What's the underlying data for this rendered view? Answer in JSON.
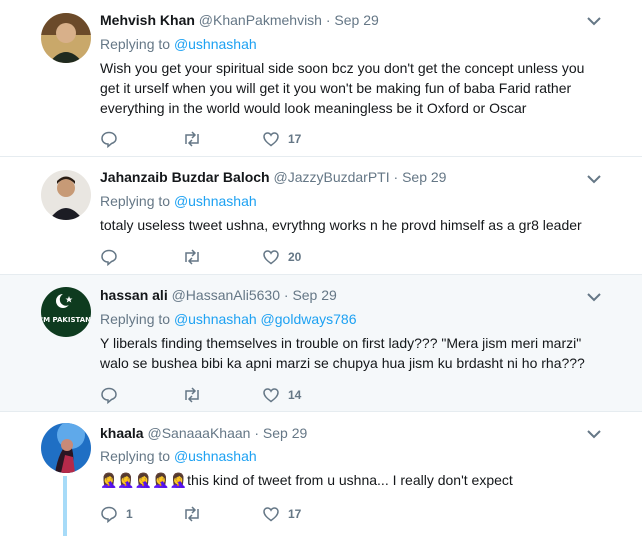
{
  "colors": {
    "link": "#1da1f2",
    "muted": "#657786",
    "thread": "#a7dbf8",
    "highlight_bg": "#f5f8fa"
  },
  "icons": {
    "reply": "reply-icon",
    "retweet": "retweet-icon",
    "like": "heart-icon",
    "menu": "chevron-down-icon"
  },
  "tweets": [
    {
      "name": "Mehvish Khan",
      "handle": "@KhanPakmehvish",
      "sep": "·",
      "date": "Sep 29",
      "replying_prefix": "Replying to",
      "replying_to": [
        "@ushnashah"
      ],
      "text": "Wish you get your spiritual side soon bcz you don't get the concept unless you get it urself when you will get it you won't be making fun of baba Farid rather everything in the world would look meaningless be it Oxford or Oscar",
      "reply_count": "",
      "retweet_count": "",
      "like_count": "17"
    },
    {
      "name": "Jahanzaib Buzdar Baloch",
      "handle": "@JazzyBuzdarPTI",
      "sep": "·",
      "date": "Sep 29",
      "replying_prefix": "Replying to",
      "replying_to": [
        "@ushnashah"
      ],
      "text": "totaly useless tweet ushna, evrythng works n he provd himself as a gr8 leader",
      "reply_count": "",
      "retweet_count": "",
      "like_count": "20"
    },
    {
      "name": "hassan ali",
      "handle": "@HassanAli5630",
      "sep": "·",
      "date": "Sep 29",
      "replying_prefix": "Replying to",
      "replying_to": [
        "@ushnashah",
        "@goldways786"
      ],
      "text": "Y liberals finding themselves in trouble on first lady??? \"Mera jism meri marzi\" walo se bushea bibi ka apni marzi se chupya hua jism ku brdasht ni ho rha???",
      "avatar_text": "I'M PAKISTANI",
      "reply_count": "",
      "retweet_count": "",
      "like_count": "14"
    },
    {
      "name": "khaala",
      "handle": "@SanaaaKhaan",
      "sep": "·",
      "date": "Sep 29",
      "replying_prefix": "Replying to",
      "replying_to": [
        "@ushnashah"
      ],
      "text": "🤦‍♀️🤦‍♀️🤦‍♀️🤦‍♀️🤦‍♀️this kind of tweet from u ushna... I really don't expect",
      "reply_count": "1",
      "retweet_count": "",
      "like_count": "17"
    }
  ]
}
